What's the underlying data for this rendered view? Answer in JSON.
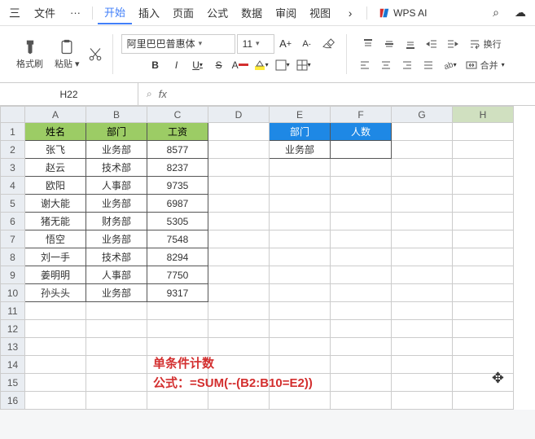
{
  "titlebar": {
    "menu_ic": "三",
    "file": "文件",
    "more": "···",
    "tabs": [
      "开始",
      "插入",
      "页面",
      "公式",
      "数据",
      "审阅",
      "视图"
    ],
    "activeTab": 0,
    "chev": "›",
    "ai_label": "WPS AI",
    "search_ic": "⌕",
    "cloud_ic": "☁"
  },
  "ribbon": {
    "brush": "格式刷",
    "paste": "粘贴",
    "font_name": "阿里巴巴普惠体",
    "font_size": "11",
    "wrap": "换行",
    "merge": "合并"
  },
  "namebox": {
    "ref": "H22",
    "fx": "fx",
    "search": "⌕"
  },
  "columns": [
    "A",
    "B",
    "C",
    "D",
    "E",
    "F",
    "G",
    "H"
  ],
  "rows": [
    "1",
    "2",
    "3",
    "4",
    "5",
    "6",
    "7",
    "8",
    "9",
    "10",
    "11",
    "12",
    "13",
    "14",
    "15",
    "16"
  ],
  "headers": {
    "a": "姓名",
    "b": "部门",
    "c": "工资",
    "e": "部门",
    "f": "人数"
  },
  "table": [
    {
      "a": "张飞",
      "b": "业务部",
      "c": "8577"
    },
    {
      "a": "赵云",
      "b": "技术部",
      "c": "8237"
    },
    {
      "a": "欧阳",
      "b": "人事部",
      "c": "9735"
    },
    {
      "a": "谢大能",
      "b": "业务部",
      "c": "6987"
    },
    {
      "a": "猪无能",
      "b": "财务部",
      "c": "5305"
    },
    {
      "a": "悟空",
      "b": "业务部",
      "c": "7548"
    },
    {
      "a": "刘一手",
      "b": "技术部",
      "c": "8294"
    },
    {
      "a": "姜明明",
      "b": "人事部",
      "c": "7750"
    },
    {
      "a": "孙头头",
      "b": "业务部",
      "c": "9317"
    }
  ],
  "side": {
    "e2": "业务部",
    "f2": ""
  },
  "annot": {
    "l1": "单条件计数",
    "l2": "公式：=SUM(--(B2:B10=E2))"
  },
  "chart_data": {
    "type": "table",
    "title": "单条件计数",
    "formula": "=SUM(--(B2:B10=E2))",
    "columns": [
      "姓名",
      "部门",
      "工资"
    ],
    "rows": [
      [
        "张飞",
        "业务部",
        8577
      ],
      [
        "赵云",
        "技术部",
        8237
      ],
      [
        "欧阳",
        "人事部",
        9735
      ],
      [
        "谢大能",
        "业务部",
        6987
      ],
      [
        "猪无能",
        "财务部",
        5305
      ],
      [
        "悟空",
        "业务部",
        7548
      ],
      [
        "刘一手",
        "技术部",
        8294
      ],
      [
        "姜明明",
        "人事部",
        7750
      ],
      [
        "孙头头",
        "业务部",
        9317
      ]
    ],
    "lookup": {
      "部门": "业务部",
      "人数": null
    }
  }
}
